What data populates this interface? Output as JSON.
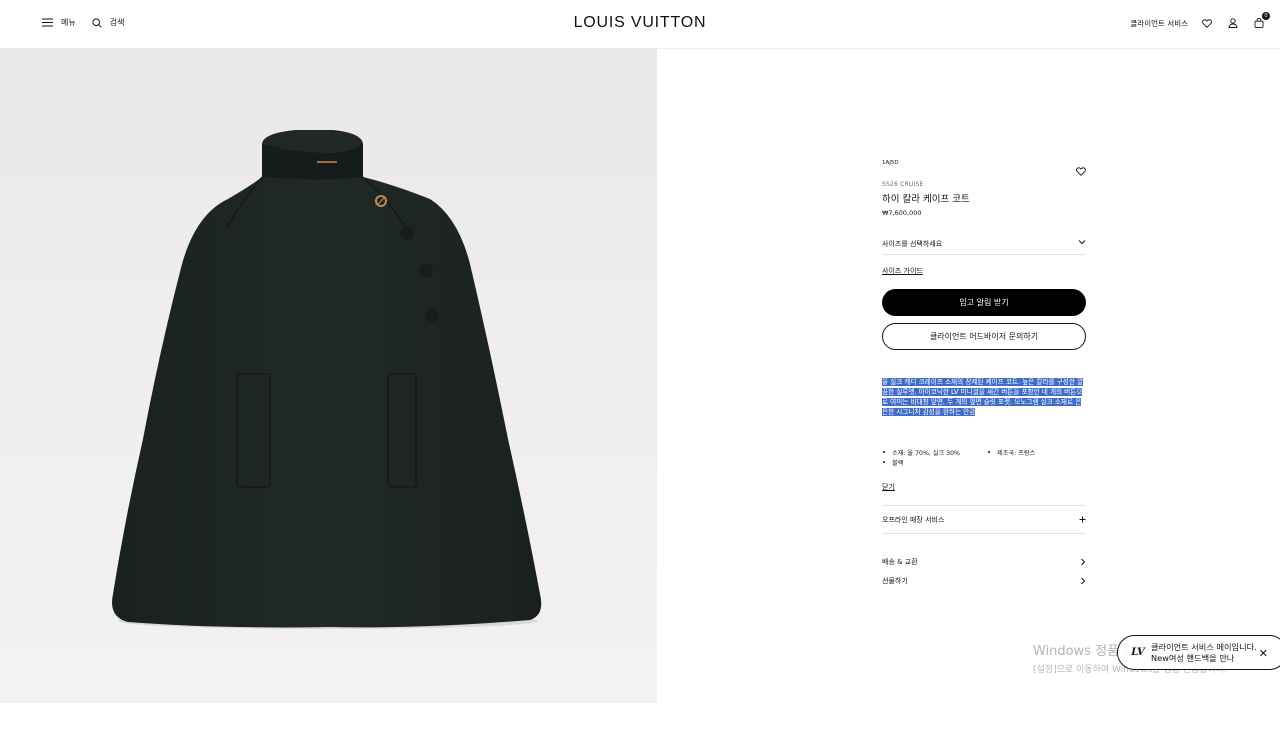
{
  "header": {
    "menu_label": "메뉴",
    "search_label": "검색",
    "brand": "LOUIS VUITTON",
    "client_service_label": "클라이언트 서비스",
    "cart_count": "0"
  },
  "product": {
    "sku": "1AJ5D",
    "collection": "SS26 CRUISE",
    "name": "하이 칼라 케이프 코트",
    "price": "₩7,600,000",
    "size_select_label": "사이즈를 선택하세요",
    "size_guide_label": "사이즈 가이드",
    "notify_button": "입고 알림 받기",
    "advisor_button": "클라이언트 어드바이저 문의하기",
    "description": "울 실크 캐디 크레이프 소재의 정제된 케이프 코트. 높은 칼라를 구성한 깔끔한 실루엣. 아이코닉한 LV 미니셜을 새긴 버튼을 포함한 네 개의 버튼으로 여미는 비대칭 앞면. 두 개의 옆면 슬릿 포켓. 모노그램 실크 소재로 은은한 시그니처 감성을 완하는 안감",
    "specs": [
      "소재: 울 70%, 실크 30%",
      "제조국: 프랑스",
      "블랙"
    ],
    "close_label": "닫기",
    "accordion_offline": "오프라인 매장 서비스",
    "link_shipping": "배송 & 교환",
    "link_gift": "선물하기"
  },
  "watermark": {
    "line1": "Windows 정품 인증",
    "line2": "[설정]으로 이동하여 Windows를 정품 인증합니다."
  },
  "chat": {
    "logo": "LV",
    "text": "클라이언트 서비스 메이입니다. New여성 핸드백을 만나"
  },
  "colors": {
    "text": "#19110b",
    "coat": "#1d2422",
    "highlight": "#3d6cc9"
  },
  "icons": [
    "menu-icon",
    "search-icon",
    "heart-icon",
    "user-icon",
    "bag-icon",
    "chevron-down-icon",
    "plus-icon",
    "chevron-right-icon",
    "close-icon"
  ]
}
